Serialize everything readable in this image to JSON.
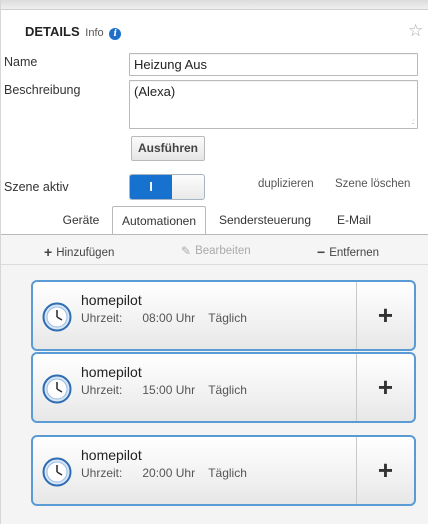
{
  "header": {
    "title": "DETAILS",
    "subtitle": "Info",
    "info_icon": "info-icon",
    "star_icon": "star-outline-icon"
  },
  "form": {
    "name_label": "Name",
    "name_value": "Heizung Aus",
    "description_label": "Beschreibung",
    "description_value": "(Alexa)",
    "run_label": "Ausführen",
    "scene_label": "Szene aktiv",
    "toggle_on_label": "I",
    "duplicate_label": "duplizieren",
    "delete_label": "Szene löschen"
  },
  "tabs": [
    {
      "label": "Geräte",
      "active": false
    },
    {
      "label": "Automationen",
      "active": true
    },
    {
      "label": "Sendersteuerung",
      "active": false
    },
    {
      "label": "E-Mail",
      "active": false
    }
  ],
  "toolbar": {
    "add_label": "Hinzufügen",
    "edit_label": "Bearbeiten",
    "remove_label": "Entfernen"
  },
  "automations": [
    {
      "title": "homepilot",
      "time_label": "Uhrzeit:",
      "time": "08:00 Uhr",
      "repeat": "Täglich"
    },
    {
      "title": "homepilot",
      "time_label": "Uhrzeit:",
      "time": "15:00 Uhr",
      "repeat": "Täglich"
    },
    {
      "title": "homepilot",
      "time_label": "Uhrzeit:",
      "time": "20:00 Uhr",
      "repeat": "Täglich"
    }
  ],
  "colors": {
    "accent": "#1772cf",
    "card_border": "#5b9bd5"
  }
}
